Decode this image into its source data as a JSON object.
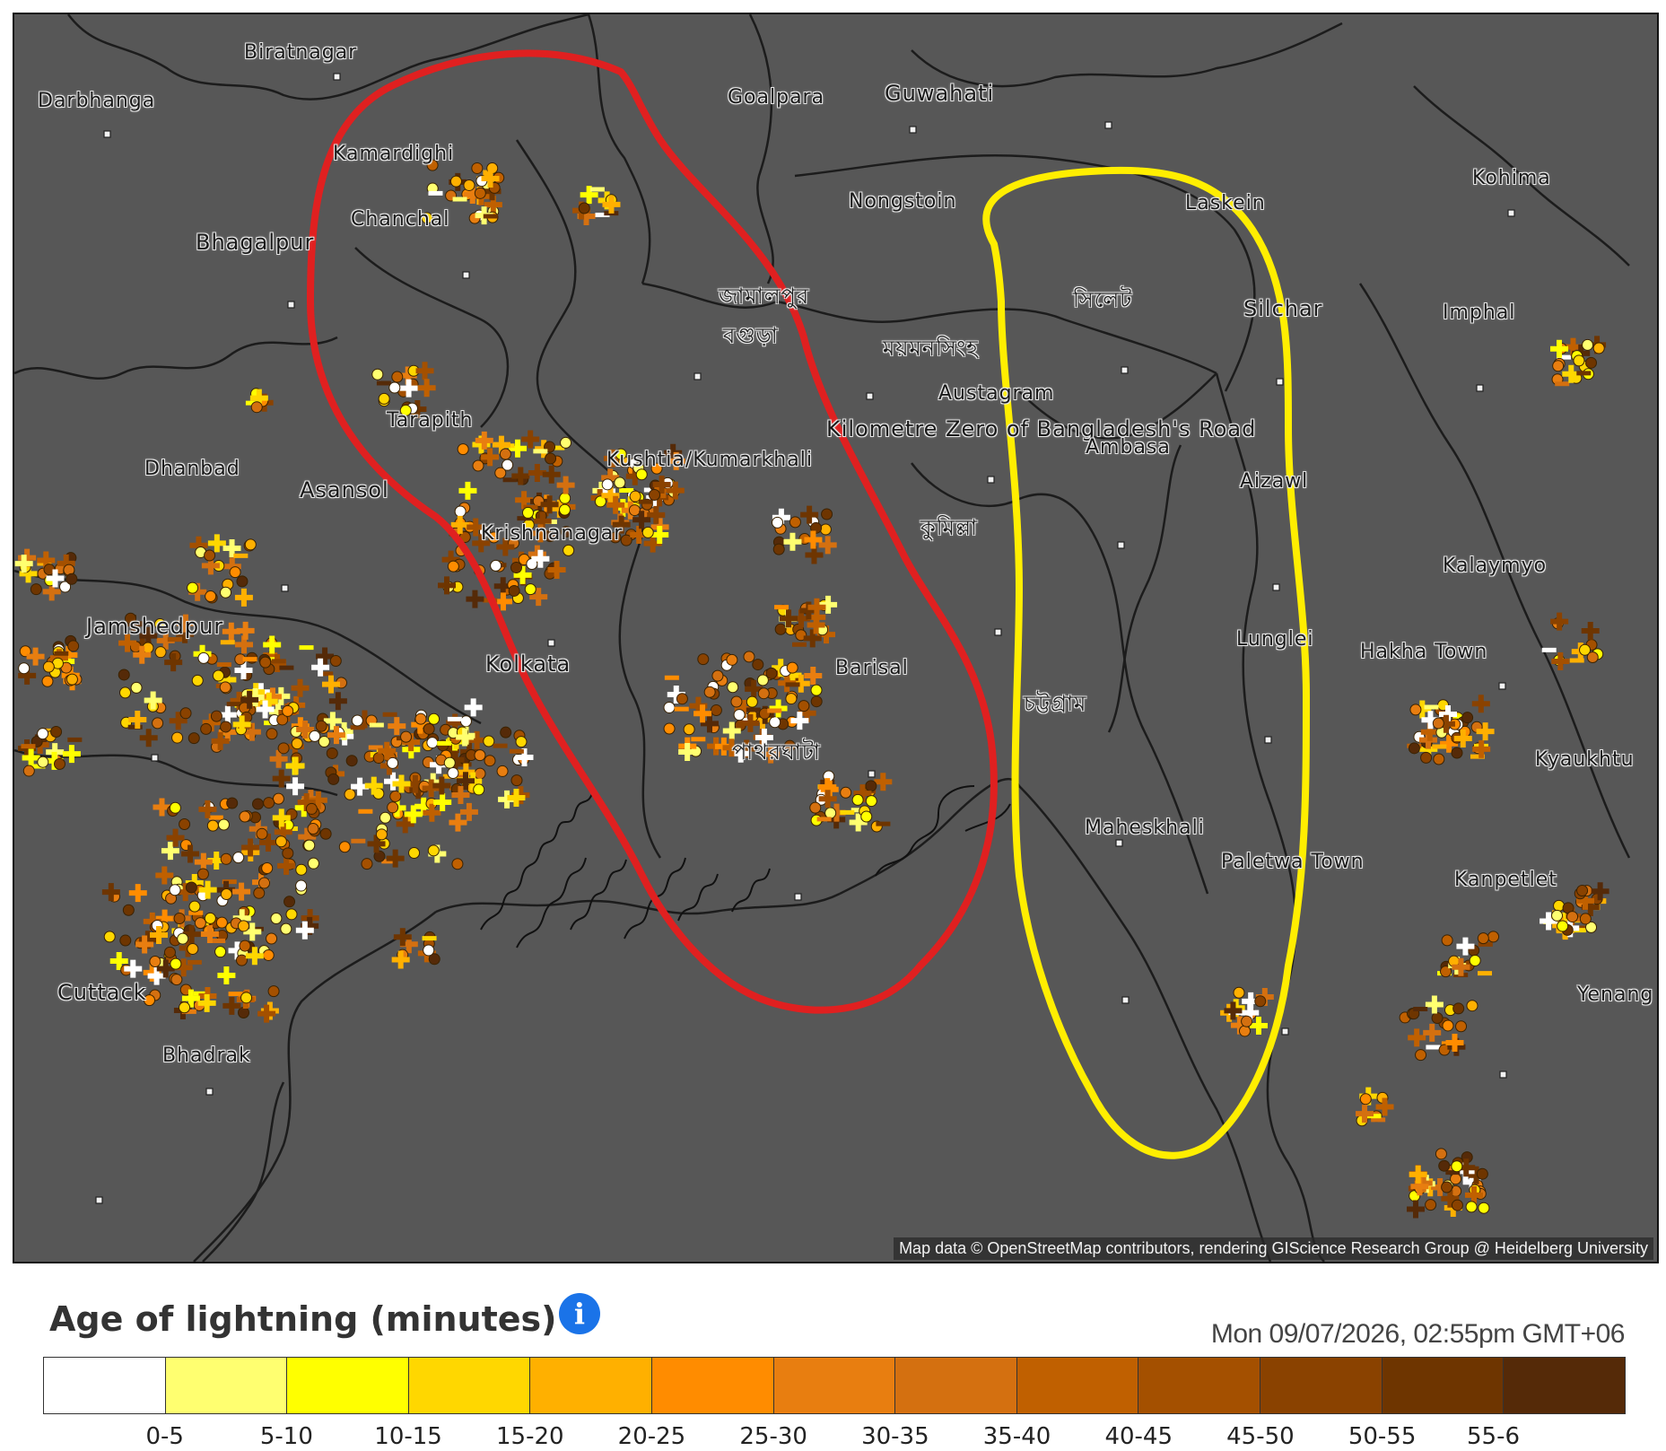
{
  "map": {
    "attribution": "Map data © OpenStreetMap contributors, rendering GIScience Research Group @ Heidelberg University",
    "background_color": "#575757",
    "annotation_colors": {
      "red_outline": "#e02020",
      "yellow_outline": "#ffee00"
    },
    "cities": [
      {
        "name": "Biratnagar",
        "id": "city-biratnagar"
      },
      {
        "name": "Darbhanga",
        "id": "city-darbhanga"
      },
      {
        "name": "Goalpara",
        "id": "city-goalpara"
      },
      {
        "name": "Guwahati",
        "id": "city-guwahati"
      },
      {
        "name": "Kohima",
        "id": "city-kohima"
      },
      {
        "name": "Kamardighi",
        "id": "city-kamardighi"
      },
      {
        "name": "Chanchal",
        "id": "city-chanchal"
      },
      {
        "name": "Bhagalpur",
        "id": "city-bhagalpur"
      },
      {
        "name": "Nongstoin",
        "id": "city-nongstoin"
      },
      {
        "name": "Laskein",
        "id": "city-laskein"
      },
      {
        "name": "Silchar",
        "id": "city-silchar"
      },
      {
        "name": "Imphal",
        "id": "city-imphal"
      },
      {
        "name": "সিলেট",
        "id": "city-sylhet"
      },
      {
        "name": "জামালপুর",
        "id": "city-jamalpur"
      },
      {
        "name": "বগুড়া",
        "id": "city-bogura"
      },
      {
        "name": "ময়মনসিংহ",
        "id": "city-mymensingh"
      },
      {
        "name": "Austagram",
        "id": "city-austagram"
      },
      {
        "name": "Tarapith",
        "id": "city-tarapith"
      },
      {
        "name": "Dhanbad",
        "id": "city-dhanbad"
      },
      {
        "name": "Asansol",
        "id": "city-asansol"
      },
      {
        "name": "Kushtia/Kumarkhali",
        "id": "city-kumarkhali"
      },
      {
        "name": "Kilometre Zero of Bangladesh's Road",
        "id": "city-kilometre-zero"
      },
      {
        "name": "Ambasa",
        "id": "city-ambasa"
      },
      {
        "name": "Aizawl",
        "id": "city-aizawl"
      },
      {
        "name": "Krishnanagar",
        "id": "city-krishnanagar"
      },
      {
        "name": "কুমিল্লা",
        "id": "city-cumilla"
      },
      {
        "name": "Kalaymyo",
        "id": "city-kalaymyo"
      },
      {
        "name": "Jamshedpur",
        "id": "city-jamshedpur"
      },
      {
        "name": "Lunglei",
        "id": "city-lunglei"
      },
      {
        "name": "Barisal",
        "id": "city-barisal"
      },
      {
        "name": "Hakha Town",
        "id": "city-hakha"
      },
      {
        "name": "Kolkata",
        "id": "city-kolkata"
      },
      {
        "name": "চট্টগ্রাম",
        "id": "city-chattogram"
      },
      {
        "name": "পাথরঘাটা",
        "id": "city-patharghata"
      },
      {
        "name": "Kyaukhtu",
        "id": "city-kyauk"
      },
      {
        "name": "Maheskhali",
        "id": "city-maheskhali"
      },
      {
        "name": "Paletwa Town",
        "id": "city-paletwa"
      },
      {
        "name": "Kanpetlet",
        "id": "city-kanpetlet"
      },
      {
        "name": "Bhadrak",
        "id": "city-bhadrak"
      },
      {
        "name": "Cuttack",
        "id": "city-cuttack"
      },
      {
        "name": "Yenang",
        "id": "city-yenang"
      }
    ]
  },
  "legend": {
    "title": "Age of lightning (minutes)",
    "info_icon": "info-icon",
    "timestamp": "Mon 09/07/2026, 02:55pm GMT+06",
    "colors": [
      "#ffffff",
      "#ffff70",
      "#ffff00",
      "#ffd700",
      "#ffb000",
      "#ff8c00",
      "#e87e10",
      "#d47010",
      "#c06000",
      "#a45000",
      "#8a4200",
      "#6e3500",
      "#552a08"
    ],
    "tick_labels": [
      "0-5",
      "5-10",
      "10-15",
      "15-20",
      "20-25",
      "25-30",
      "30-35",
      "35-40",
      "40-45",
      "45-50",
      "50-55",
      "55-6"
    ]
  }
}
